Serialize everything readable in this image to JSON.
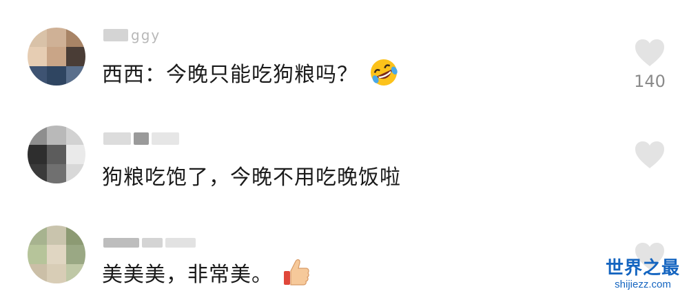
{
  "comments": [
    {
      "username_visible": "ggy",
      "text": "西西：今晚只能吃狗粮吗？",
      "emoji": "rolling-on-floor-laughing-icon",
      "likes": "140"
    },
    {
      "username_visible": "",
      "text": "狗粮吃饱了，今晚不用吃晚饭啦",
      "emoji": "",
      "likes": ""
    },
    {
      "username_visible": "",
      "text": "美美美，非常美。",
      "emoji": "thumbs-up-icon",
      "likes": ""
    }
  ],
  "watermark": {
    "title": "世界之最",
    "url": "shijiezz.com"
  },
  "colors": {
    "heart": "#e3e3e3",
    "text": "#1a1a1a",
    "count": "#8a8a8a",
    "watermark": "#1565c0"
  }
}
